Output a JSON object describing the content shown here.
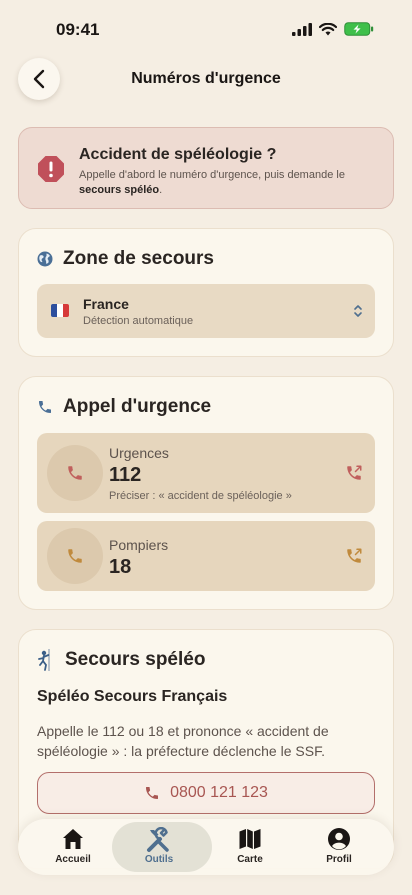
{
  "status": {
    "time": "09:41"
  },
  "header": {
    "title": "Numéros d'urgence"
  },
  "alert": {
    "title": "Accident de spéléologie ?",
    "text_prefix": "Appelle d'abord le numéro d'urgence, puis demande le ",
    "text_bold": "secours spéléo",
    "text_suffix": "."
  },
  "zone": {
    "title": "Zone de secours",
    "country": "France",
    "detection": "Détection automatique",
    "flag_colors": [
      "#2d4f9e",
      "#ffffff",
      "#d63a3a"
    ]
  },
  "emergency": {
    "title": "Appel d'urgence",
    "items": [
      {
        "label": "Urgences",
        "number": "112",
        "note": "Préciser : « accident de spéléologie »",
        "color": "#c0605d"
      },
      {
        "label": "Pompiers",
        "number": "18",
        "note": "",
        "color": "#c08a3d"
      }
    ]
  },
  "speleo": {
    "title": "Secours spéléo",
    "org": "Spéléo Secours Français",
    "description": "Appelle le 112 ou 18 et prononce « accident de spéléologie » : la préfecture déclenche le SSF.",
    "phone": "0800 121 123"
  },
  "tabs": [
    {
      "label": "Accueil",
      "icon": "home-icon",
      "active": false
    },
    {
      "label": "Outils",
      "icon": "tools-icon",
      "active": true
    },
    {
      "label": "Carte",
      "icon": "map-icon",
      "active": false
    },
    {
      "label": "Profil",
      "icon": "profile-icon",
      "active": false
    }
  ],
  "colors": {
    "accent": "#4f6f8f",
    "danger": "#c0505a",
    "background": "#f5eee3"
  }
}
